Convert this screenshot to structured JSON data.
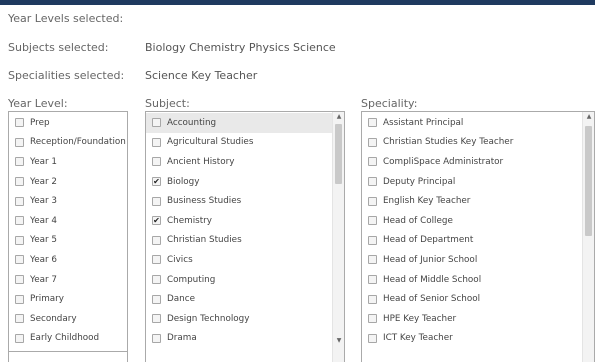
{
  "summary": {
    "year_levels_label": "Year Levels selected:",
    "year_levels_value": "",
    "subjects_label": "Subjects selected:",
    "subjects_value": "Biology Chemistry Physics Science",
    "specialities_label": "Specialities selected:",
    "specialities_value": "Science Key Teacher"
  },
  "year_level": {
    "label": "Year Level:",
    "options": [
      {
        "label": "Prep",
        "checked": false
      },
      {
        "label": "Reception/Foundation",
        "checked": false
      },
      {
        "label": "Year 1",
        "checked": false
      },
      {
        "label": "Year 2",
        "checked": false
      },
      {
        "label": "Year 3",
        "checked": false
      },
      {
        "label": "Year 4",
        "checked": false
      },
      {
        "label": "Year 5",
        "checked": false
      },
      {
        "label": "Year 6",
        "checked": false
      },
      {
        "label": "Year 7",
        "checked": false
      },
      {
        "label": "Primary",
        "checked": false
      },
      {
        "label": "Secondary",
        "checked": false
      },
      {
        "label": "Early Childhood",
        "checked": false
      }
    ]
  },
  "subject": {
    "label": "Subject:",
    "options": [
      {
        "label": "Accounting",
        "checked": false
      },
      {
        "label": "Agricultural Studies",
        "checked": false
      },
      {
        "label": "Ancient History",
        "checked": false
      },
      {
        "label": "Biology",
        "checked": true
      },
      {
        "label": "Business Studies",
        "checked": false
      },
      {
        "label": "Chemistry",
        "checked": true
      },
      {
        "label": "Christian Studies",
        "checked": false
      },
      {
        "label": "Civics",
        "checked": false
      },
      {
        "label": "Computing",
        "checked": false
      },
      {
        "label": "Dance",
        "checked": false
      },
      {
        "label": "Design Technology",
        "checked": false
      },
      {
        "label": "Drama",
        "checked": false
      }
    ]
  },
  "speciality": {
    "label": "Speciality:",
    "options": [
      {
        "label": "Assistant Principal",
        "checked": false
      },
      {
        "label": "Christian Studies Key Teacher",
        "checked": false
      },
      {
        "label": "CompliSpace Administrator",
        "checked": false
      },
      {
        "label": "Deputy Principal",
        "checked": false
      },
      {
        "label": "English Key Teacher",
        "checked": false
      },
      {
        "label": "Head of College",
        "checked": false
      },
      {
        "label": "Head of Department",
        "checked": false
      },
      {
        "label": "Head of Junior School",
        "checked": false
      },
      {
        "label": "Head of Middle School",
        "checked": false
      },
      {
        "label": "Head of Senior School",
        "checked": false
      },
      {
        "label": "HPE Key Teacher",
        "checked": false
      },
      {
        "label": "ICT Key Teacher",
        "checked": false
      }
    ]
  },
  "icons": {
    "scroll_up": "▲",
    "scroll_down": "▼",
    "check": "✔"
  }
}
